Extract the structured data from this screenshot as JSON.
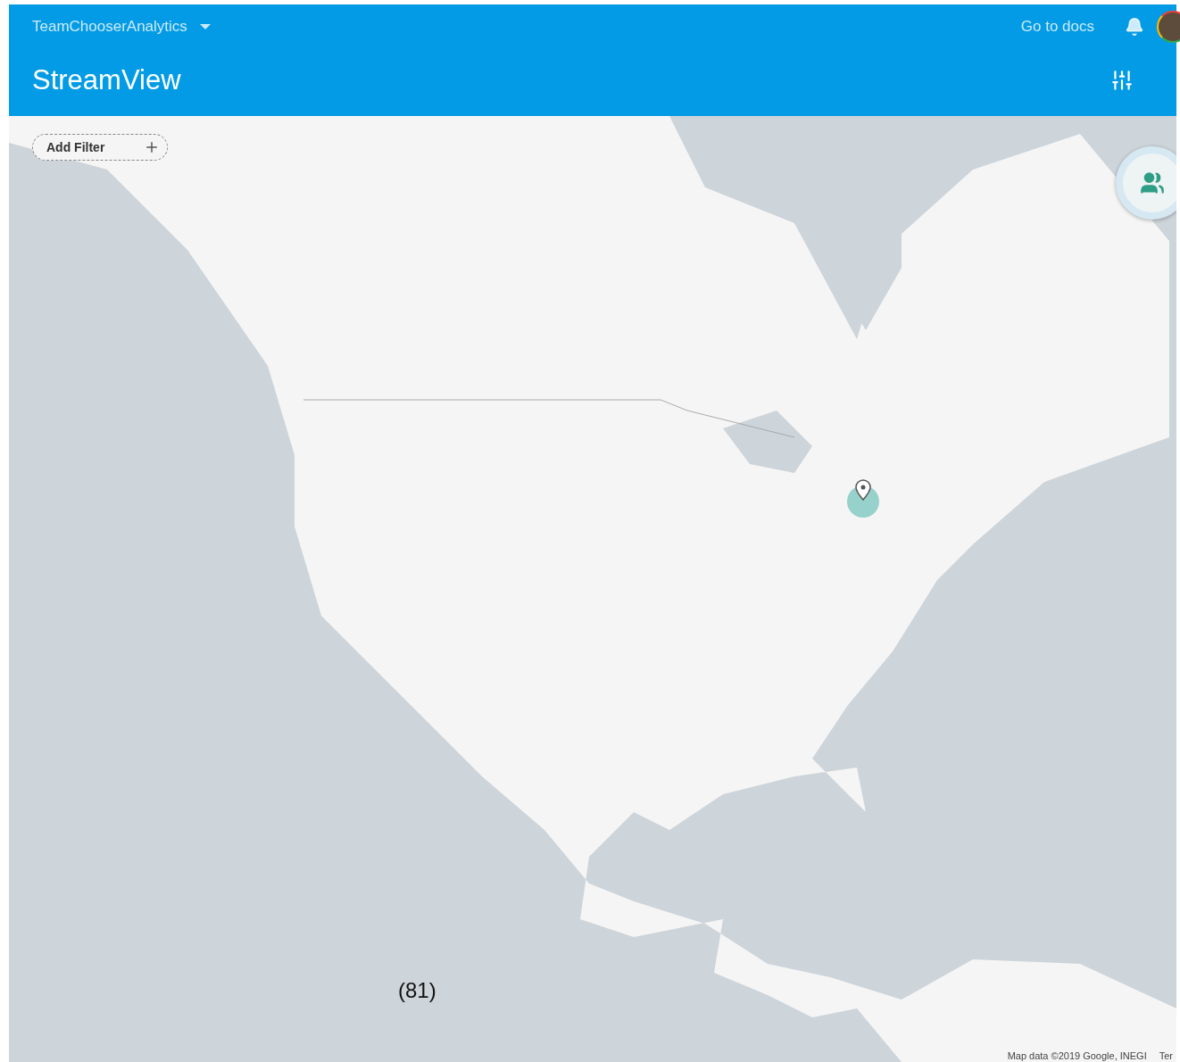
{
  "header": {
    "project": "TeamChooserAnalytics",
    "docs_link": "Go to docs",
    "title": "StreamView"
  },
  "filter": {
    "label": "Add Filter"
  },
  "map": {
    "attribution": "Map data ©2019 Google, INEGI",
    "terms": "Ter"
  },
  "caption": "(81)"
}
